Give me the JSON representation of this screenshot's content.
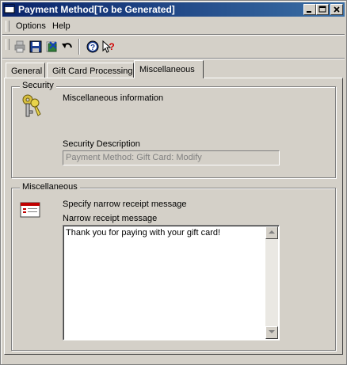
{
  "window": {
    "title": "Payment Method[To be Generated]"
  },
  "menu": {
    "items": [
      {
        "label": "Options"
      },
      {
        "label": "Help"
      }
    ]
  },
  "toolbar": {
    "buttons": [
      "print-icon",
      "save-icon",
      "delete-icon",
      "undo-icon",
      "help-icon",
      "whats-this-icon"
    ]
  },
  "tabs": [
    {
      "label": "General",
      "active": false
    },
    {
      "label": "Gift Card Processing",
      "active": false
    },
    {
      "label": "Miscellaneous",
      "active": true
    }
  ],
  "security": {
    "group_title": "Security",
    "heading": "Miscellaneous information",
    "description_label": "Security Description",
    "description_value": "Payment Method: Gift Card: Modify"
  },
  "misc": {
    "group_title": "Miscellaneous",
    "heading": "Specify narrow receipt message",
    "message_label": "Narrow receipt message",
    "message_value": "Thank you for paying with your gift card!"
  },
  "colors": {
    "titlebar_start": "#0a246a",
    "titlebar_end": "#3a6ea5",
    "face": "#d4d0c8"
  }
}
